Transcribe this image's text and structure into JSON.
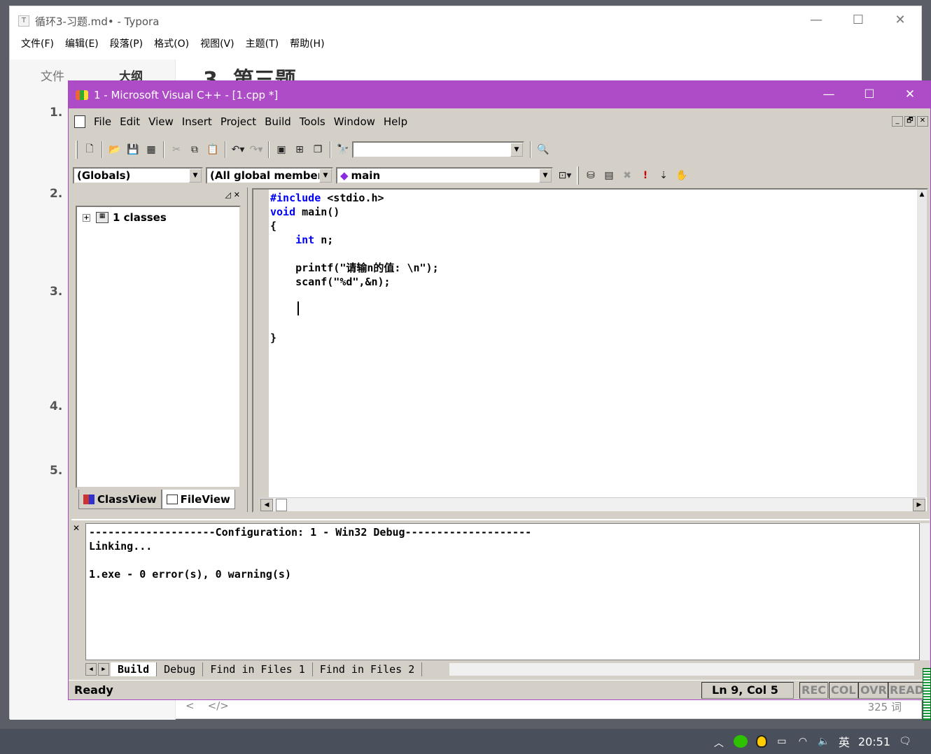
{
  "typora": {
    "title": "循环3-习题.md• - Typora",
    "logo": "T",
    "win_buttons": [
      "—",
      "☐",
      "✕"
    ],
    "menu": [
      "文件(F)",
      "编辑(E)",
      "段落(P)",
      "格式(O)",
      "视图(V)",
      "主题(T)",
      "帮助(H)"
    ],
    "sidebar_tabs": [
      "文件",
      "大纲"
    ],
    "heading": "3. 第三题",
    "outline_numbers": [
      "1.",
      "2.",
      "3.",
      "4.",
      "5."
    ],
    "word_count": "325 词",
    "nav_icons": [
      "<",
      "</>"
    ]
  },
  "vc": {
    "title": "1 - Microsoft Visual C++ - [1.cpp *]",
    "win_buttons": [
      "—",
      "☐",
      "✕"
    ],
    "menu": [
      "File",
      "Edit",
      "View",
      "Insert",
      "Project",
      "Build",
      "Tools",
      "Window",
      "Help"
    ],
    "mdi_buttons": [
      "_",
      "🗗",
      "✕"
    ],
    "find_combo_value": "",
    "globals_combo": "(Globals)",
    "members_combo": "(All global members",
    "function_combo": "main",
    "workspace": {
      "tree_root": "1 classes",
      "tabs": [
        "ClassView",
        "FileView"
      ]
    },
    "code_lines": [
      {
        "pre": "#include",
        "rest": " <stdio.h>"
      },
      {
        "pre": "void",
        "rest": " main()"
      },
      {
        "pre": "",
        "rest": "{"
      },
      {
        "pre": "    int",
        "rest": " n;"
      },
      {
        "pre": "",
        "rest": ""
      },
      {
        "pre": "",
        "rest": "    printf(\"请输n的值: \\n\");"
      },
      {
        "pre": "",
        "rest": "    scanf(\"%d\",&n);"
      },
      {
        "pre": "",
        "rest": ""
      },
      {
        "pre": "",
        "rest": ""
      },
      {
        "pre": "",
        "rest": ""
      },
      {
        "pre": "",
        "rest": "}"
      }
    ],
    "output": {
      "lines": [
        "--------------------Configuration: 1 - Win32 Debug--------------------",
        "Linking...",
        "",
        "1.exe - 0 error(s), 0 warning(s)"
      ],
      "tabs": [
        "Build",
        "Debug",
        "Find in Files 1",
        "Find in Files 2"
      ]
    },
    "status": {
      "ready": "Ready",
      "position": "Ln 9, Col 5",
      "indicators": [
        "REC",
        "COL",
        "OVR",
        "READ"
      ]
    }
  },
  "taskbar": {
    "ime": "英",
    "time": "20:51"
  }
}
